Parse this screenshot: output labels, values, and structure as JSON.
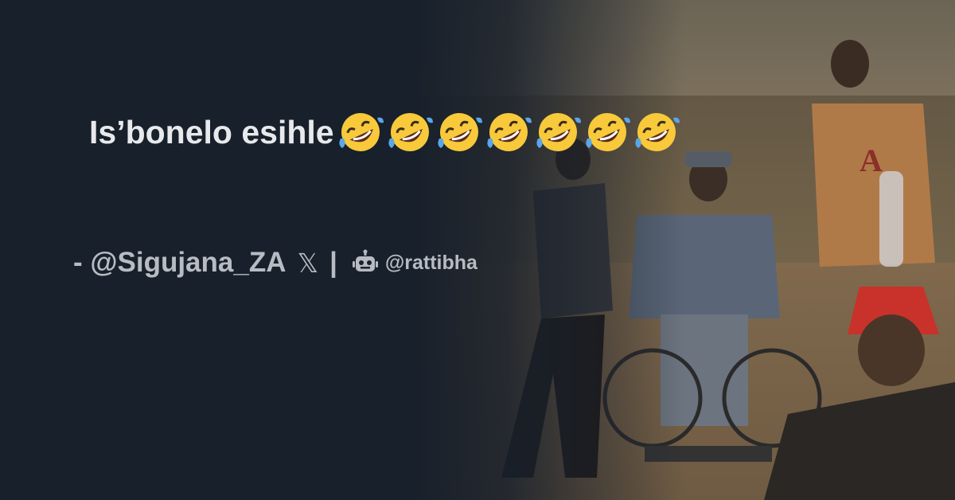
{
  "post": {
    "text": "Is’bonelo esihle",
    "emoji_name": "rolling-on-the-floor-laughing-emoji",
    "emoji_count": 7,
    "author_line": "- @Sigujana_ZA",
    "x_logo": "𝕏",
    "separator": "|",
    "site_handle": "@rattibha"
  },
  "colors": {
    "background": "#18202b",
    "headline": "#e7e9ec",
    "byline": "#b7bcc3",
    "emoji_face": "#f7c93b",
    "emoji_tear": "#5aa6e8"
  }
}
